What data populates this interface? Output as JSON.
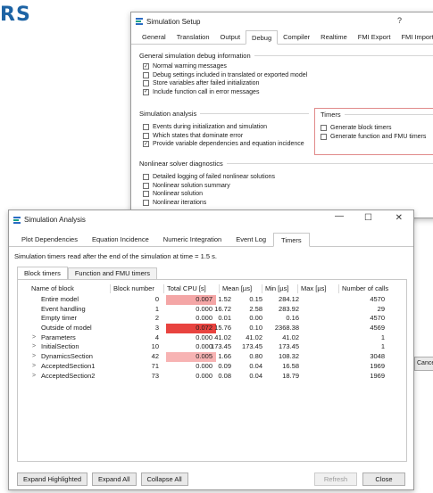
{
  "heading_fragment": "RS",
  "setup": {
    "title": "Simulation Setup",
    "help_glyph": "?",
    "tabs": [
      "General",
      "Translation",
      "Output",
      "Debug",
      "Compiler",
      "Realtime",
      "FMI Export",
      "FMI Import"
    ],
    "active_tab": "Debug",
    "general": {
      "title": "General simulation debug information",
      "items": [
        {
          "label": "Normal warning messages",
          "checked": true
        },
        {
          "label": "Debug settings included in translated or exported model",
          "checked": false
        },
        {
          "label": "Store variables after failed initialization",
          "checked": false
        },
        {
          "label": "Include function call in error messages",
          "checked": true
        }
      ]
    },
    "analysis": {
      "title": "Simulation analysis",
      "items": [
        {
          "label": "Events during initialization and simulation",
          "checked": false
        },
        {
          "label": "Which states that dominate error",
          "checked": false
        },
        {
          "label": "Provide variable dependencies and equation incidence",
          "checked": true
        }
      ]
    },
    "timers": {
      "title": "Timers",
      "items": [
        {
          "label": "Generate block timers",
          "checked": false
        },
        {
          "label": "Generate function and FMU timers",
          "checked": false
        }
      ]
    },
    "nonlinear": {
      "title": "Nonlinear solver diagnostics",
      "items": [
        {
          "label": "Detailed logging of failed nonlinear solutions",
          "checked": false
        },
        {
          "label": "Nonlinear solution summary",
          "checked": false
        },
        {
          "label": "Nonlinear solution",
          "checked": false
        },
        {
          "label": "Nonlinear iterations",
          "checked": false
        }
      ]
    },
    "cancel_peek": "Cance"
  },
  "analysis": {
    "title": "Simulation Analysis",
    "controls": {
      "minimize": "—",
      "maximize": "☐",
      "close": "✕"
    },
    "tabs": [
      "Plot Dependencies",
      "Equation Incidence",
      "Numeric Integration",
      "Event Log",
      "Timers"
    ],
    "active_tab": "Timers",
    "info": "Simulation timers read after the end of the simulation at time = 1.5 s.",
    "subtabs": [
      "Block timers",
      "Function and FMU timers"
    ],
    "active_subtab": "Block timers",
    "columns": {
      "name": "Name of block",
      "number": "Block number",
      "cpu": "Total CPU [s]",
      "mean": "Mean [µs]",
      "min": "Min [µs]",
      "max": "Max [µs]",
      "calls": "Number of calls"
    },
    "rows": [
      {
        "name": "Entire model",
        "number": "0",
        "cpu": "0.007",
        "mean": "1.52",
        "min": "0.15",
        "max": "284.12",
        "calls": "4570",
        "expandable": false,
        "highlight": "#f4a6a6"
      },
      {
        "name": "Event handling",
        "number": "1",
        "cpu": "0.000",
        "mean": "16.72",
        "min": "2.58",
        "max": "283.92",
        "calls": "29",
        "expandable": false,
        "highlight": ""
      },
      {
        "name": "Empty timer",
        "number": "2",
        "cpu": "0.000",
        "mean": "0.01",
        "min": "0.00",
        "max": "0.16",
        "calls": "4570",
        "expandable": false,
        "highlight": ""
      },
      {
        "name": "Outside of model",
        "number": "3",
        "cpu": "0.072",
        "mean": "15.76",
        "min": "0.10",
        "max": "2368.38",
        "calls": "4569",
        "expandable": false,
        "highlight": "#e8433f"
      },
      {
        "name": "Parameters",
        "number": "4",
        "cpu": "0.000",
        "mean": "41.02",
        "min": "41.02",
        "max": "41.02",
        "calls": "1",
        "expandable": true,
        "highlight": ""
      },
      {
        "name": "InitialSection",
        "number": "10",
        "cpu": "0.000",
        "mean": "173.45",
        "min": "173.45",
        "max": "173.45",
        "calls": "1",
        "expandable": true,
        "highlight": ""
      },
      {
        "name": "DynamicsSection",
        "number": "42",
        "cpu": "0.005",
        "mean": "1.66",
        "min": "0.80",
        "max": "108.32",
        "calls": "3048",
        "expandable": true,
        "highlight": "#f7b3b3"
      },
      {
        "name": "AcceptedSection1",
        "number": "71",
        "cpu": "0.000",
        "mean": "0.09",
        "min": "0.04",
        "max": "16.58",
        "calls": "1969",
        "expandable": true,
        "highlight": ""
      },
      {
        "name": "AcceptedSection2",
        "number": "73",
        "cpu": "0.000",
        "mean": "0.08",
        "min": "0.04",
        "max": "18.79",
        "calls": "1969",
        "expandable": true,
        "highlight": ""
      }
    ],
    "buttons": {
      "expand_highlighted": "Expand Highlighted",
      "expand_all": "Expand All",
      "collapse_all": "Collapse All",
      "refresh": "Refresh",
      "close": "Close"
    }
  },
  "icons": {
    "app": "simulation-app-icon",
    "tree_arrow": ">"
  }
}
